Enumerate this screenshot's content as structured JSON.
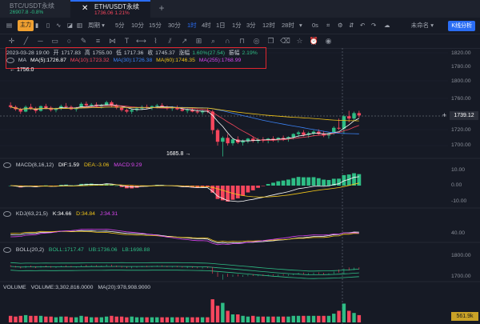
{
  "tabs": [
    {
      "title": "BTC/USDT永续",
      "price": "26907.8",
      "change": "-0.8%"
    },
    {
      "title": "ETH/USDT永续",
      "price": "1736.06",
      "change": "1.21%"
    }
  ],
  "toolbar": {
    "zhuli": "主力",
    "period": "周期",
    "intervals": [
      "5分",
      "10分",
      "15分",
      "30分",
      "1时",
      "4时",
      "1日",
      "1分",
      "3分",
      "12时",
      "28时"
    ],
    "active_interval": "1时",
    "countdown": "0s",
    "layout_name": "未命名",
    "kline_button": "K线分析"
  },
  "ohlc": {
    "datetime": "2023-03-28 19:00",
    "open_label": "开",
    "open": "1717.83",
    "high_label": "高",
    "high": "1755.00",
    "low_label": "低",
    "low": "1717.36",
    "close_label": "收",
    "close": "1745.37",
    "change_label": "涨幅",
    "change": "1.60%(27.54)",
    "amp_label": "振幅",
    "amp": "2.19%"
  },
  "ma": {
    "name": "MA",
    "ma5": "MA(5):1726.87",
    "ma10": "MA(10):1723.32",
    "ma30": "MA(30):1726.38",
    "ma60": "MA(60):1746.35",
    "ma255": "MA(255):1768.99"
  },
  "price_axis": [
    "1820.00",
    "1800.00",
    "1780.00",
    "1760.00",
    "1720.00",
    "1700.00"
  ],
  "current_price": "1739.12",
  "annotations": {
    "high": "1756.0",
    "low": "1685.8"
  },
  "macd": {
    "name": "MACD(8,16,12)",
    "dif": "DIF:1.59",
    "dea": "DEA:-3.06",
    "macd": "MACD:9.29",
    "axis": [
      "10.00",
      "0.00",
      "-10.00"
    ]
  },
  "kdj": {
    "name": "KDJ(63,21,5)",
    "k": "K:34.66",
    "d": "D:34.84",
    "j": "J:34.31",
    "axis": [
      "40.00"
    ]
  },
  "boll": {
    "name": "BOLL(20,2)",
    "boll": "BOLL:1717.47",
    "ub": "UB:1736.06",
    "lb": "LB:1698.88",
    "axis": [
      "1800.00",
      "1700.00"
    ]
  },
  "volume": {
    "name": "VOLUME",
    "vol": "VOLUME:3,302,816.0000",
    "ma20": "MA(20):978,908.9000",
    "tag": "561.9k"
  },
  "colors": {
    "up": "#2ebd85",
    "down": "#f6465d",
    "accent": "#2a6df4",
    "highlight_box": "#e0262f"
  },
  "chart_data": {
    "type": "candlestick",
    "candles": [
      [
        1752,
        1756,
        1748,
        1750
      ],
      [
        1750,
        1752,
        1745,
        1747
      ],
      [
        1747,
        1749,
        1741,
        1744
      ],
      [
        1744,
        1752,
        1743,
        1750
      ],
      [
        1750,
        1754,
        1746,
        1748
      ],
      [
        1748,
        1750,
        1742,
        1745
      ],
      [
        1745,
        1752,
        1744,
        1751
      ],
      [
        1751,
        1754,
        1747,
        1749
      ],
      [
        1749,
        1751,
        1744,
        1746
      ],
      [
        1746,
        1749,
        1743,
        1748
      ],
      [
        1748,
        1753,
        1746,
        1751
      ],
      [
        1751,
        1755,
        1748,
        1750
      ],
      [
        1750,
        1752,
        1746,
        1747
      ],
      [
        1747,
        1750,
        1744,
        1749
      ],
      [
        1749,
        1756,
        1748,
        1754
      ],
      [
        1754,
        1757,
        1750,
        1752
      ],
      [
        1752,
        1755,
        1749,
        1753
      ],
      [
        1753,
        1756,
        1750,
        1751
      ],
      [
        1751,
        1754,
        1748,
        1752
      ],
      [
        1752,
        1758,
        1751,
        1756
      ],
      [
        1756,
        1758,
        1750,
        1752
      ],
      [
        1752,
        1754,
        1747,
        1749
      ],
      [
        1749,
        1751,
        1744,
        1746
      ],
      [
        1746,
        1748,
        1742,
        1744
      ],
      [
        1744,
        1748,
        1741,
        1746
      ],
      [
        1746,
        1750,
        1744,
        1748
      ],
      [
        1748,
        1752,
        1746,
        1750
      ],
      [
        1750,
        1753,
        1747,
        1749
      ],
      [
        1749,
        1752,
        1746,
        1751
      ],
      [
        1751,
        1754,
        1748,
        1752
      ],
      [
        1752,
        1755,
        1749,
        1750
      ],
      [
        1750,
        1752,
        1746,
        1748
      ],
      [
        1748,
        1751,
        1745,
        1749
      ],
      [
        1749,
        1752,
        1746,
        1747
      ],
      [
        1747,
        1750,
        1744,
        1745
      ],
      [
        1745,
        1748,
        1742,
        1746
      ],
      [
        1746,
        1749,
        1743,
        1744
      ],
      [
        1744,
        1747,
        1741,
        1743
      ],
      [
        1743,
        1746,
        1740,
        1745
      ],
      [
        1745,
        1748,
        1742,
        1744
      ],
      [
        1744,
        1746,
        1715,
        1720
      ],
      [
        1720,
        1722,
        1700,
        1705
      ],
      [
        1705,
        1712,
        1686,
        1710
      ],
      [
        1710,
        1715,
        1700,
        1703
      ],
      [
        1703,
        1710,
        1700,
        1708
      ],
      [
        1708,
        1712,
        1702,
        1704
      ],
      [
        1704,
        1708,
        1700,
        1706
      ],
      [
        1706,
        1710,
        1703,
        1709
      ],
      [
        1709,
        1712,
        1704,
        1706
      ],
      [
        1706,
        1710,
        1703,
        1708
      ],
      [
        1708,
        1711,
        1704,
        1707
      ],
      [
        1707,
        1710,
        1703,
        1709
      ],
      [
        1709,
        1712,
        1705,
        1708
      ],
      [
        1708,
        1711,
        1704,
        1710
      ],
      [
        1710,
        1713,
        1706,
        1709
      ],
      [
        1709,
        1712,
        1705,
        1711
      ],
      [
        1711,
        1716,
        1708,
        1715
      ],
      [
        1715,
        1719,
        1711,
        1717
      ],
      [
        1717,
        1720,
        1712,
        1714
      ],
      [
        1714,
        1718,
        1710,
        1716
      ],
      [
        1716,
        1720,
        1712,
        1718
      ],
      [
        1718,
        1721,
        1713,
        1715
      ],
      [
        1715,
        1719,
        1711,
        1713
      ],
      [
        1713,
        1717,
        1709,
        1716
      ],
      [
        1716,
        1725,
        1714,
        1723
      ],
      [
        1723,
        1735,
        1720,
        1722
      ],
      [
        1722,
        1740,
        1715,
        1738
      ],
      [
        1738,
        1745,
        1730,
        1735
      ],
      [
        1735,
        1744,
        1732,
        1742
      ],
      [
        1742,
        1745,
        1736,
        1739
      ]
    ]
  }
}
